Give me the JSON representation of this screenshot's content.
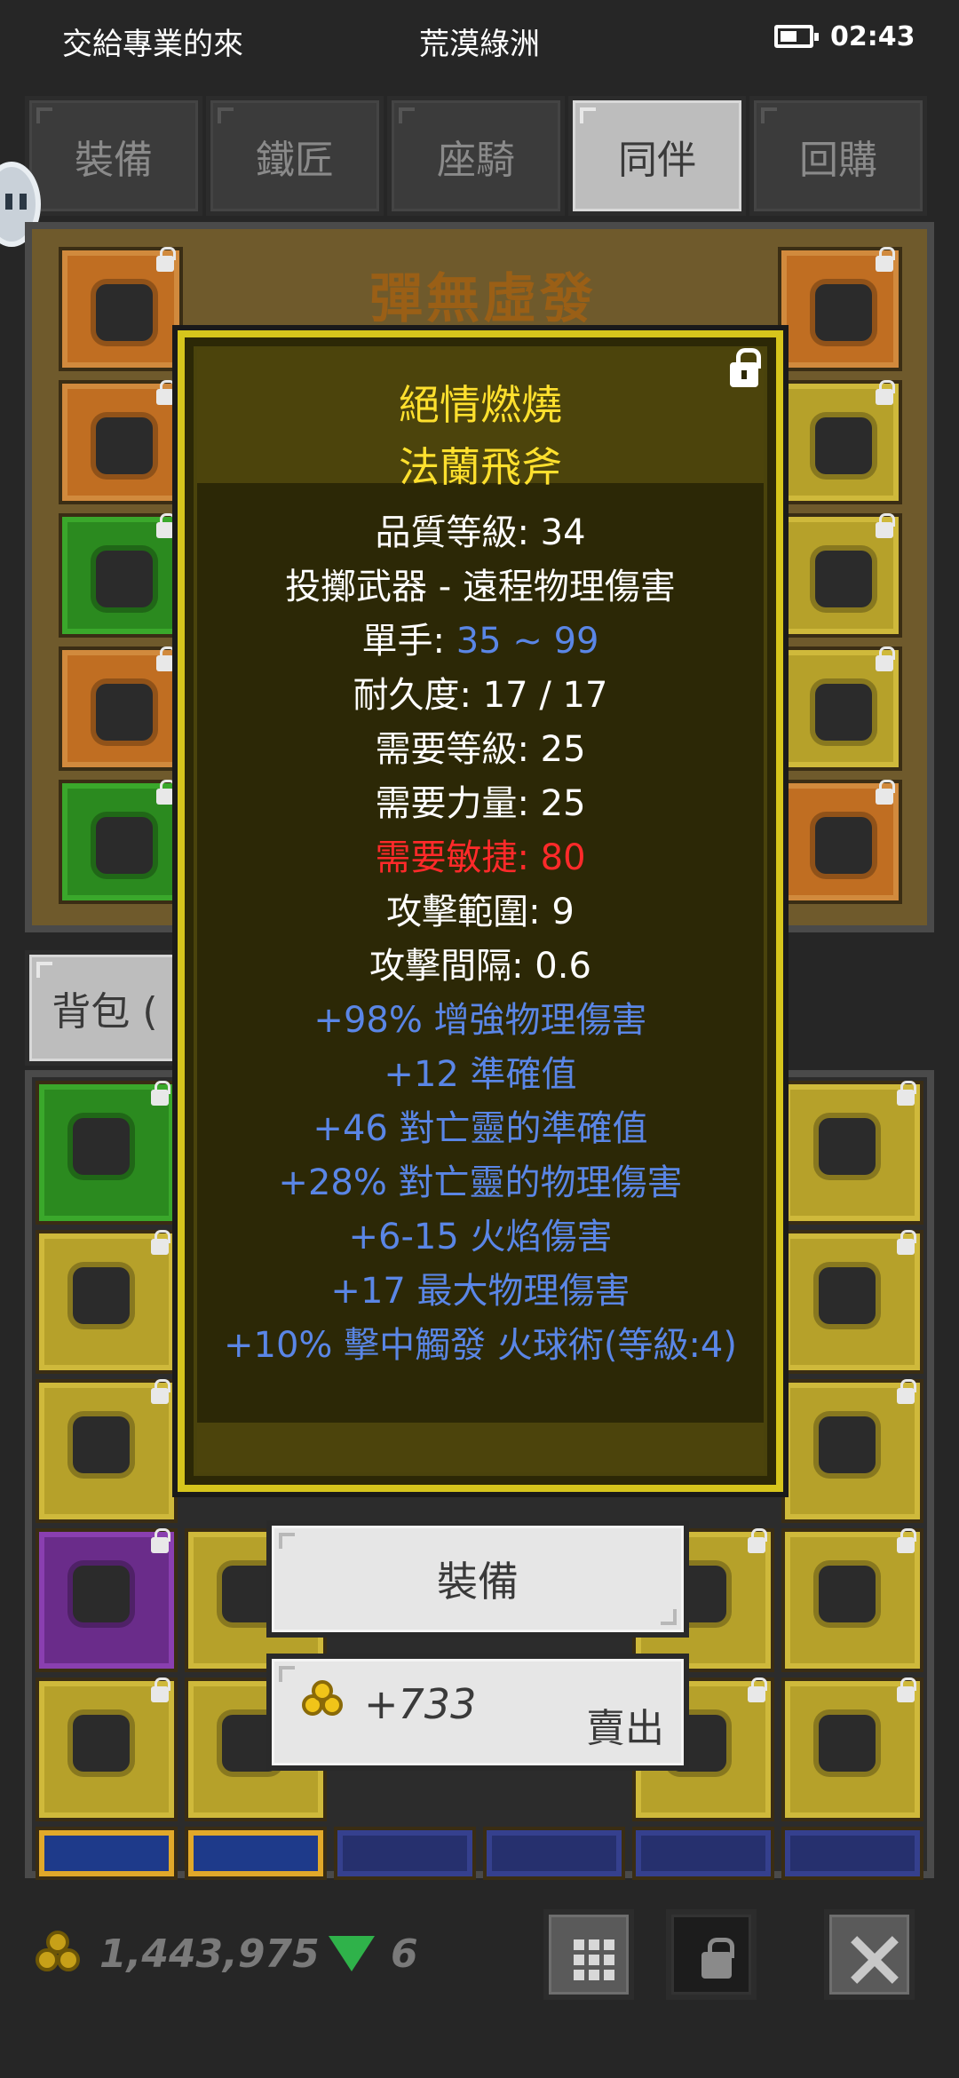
{
  "status_bar": {
    "left_text": "交給專業的來",
    "center_text": "荒漠綠洲",
    "time": "02:43"
  },
  "tabs": [
    {
      "label": "裝備",
      "active": false
    },
    {
      "label": "鐵匠",
      "active": false
    },
    {
      "label": "座騎",
      "active": false
    },
    {
      "label": "同伴",
      "active": true
    },
    {
      "label": "回購",
      "active": false
    }
  ],
  "equipment_panel": {
    "title": "彈無虛發"
  },
  "backpack_tab": {
    "label": "背包 ("
  },
  "tooltip": {
    "name_line1": "絕情燃燒",
    "name_line2": "法蘭飛斧",
    "quality": "品質等級: 34",
    "type": "投擲武器 - 遠程物理傷害",
    "damage_label": "單手: ",
    "damage_value": "35 ~ 99",
    "durability": "耐久度: 17 / 17",
    "req_level": "需要等級: 25",
    "req_strength": "需要力量: 25",
    "req_dexterity": "需要敏捷: 80",
    "attack_range": "攻擊範圍: 9",
    "attack_interval": "攻擊間隔: 0.6",
    "modifiers": [
      "+98% 增強物理傷害",
      "+12 準確值",
      "+46 對亡靈的準確值",
      "+28% 對亡靈的物理傷害",
      "+6-15 火焰傷害",
      "+17 最大物理傷害",
      "+10% 擊中觸發 火球術(等級:4)"
    ]
  },
  "actions": {
    "equip_label": "裝備",
    "sell_price": "+733",
    "sell_label": "賣出"
  },
  "bottom_bar": {
    "gold": "1,443,975",
    "gems": "6"
  },
  "colors": {
    "tooltip_border": "#d6c51c",
    "item_name": "#ffe02e",
    "stat_blue": "#5a86e6",
    "stat_red": "#ff2a2a"
  }
}
